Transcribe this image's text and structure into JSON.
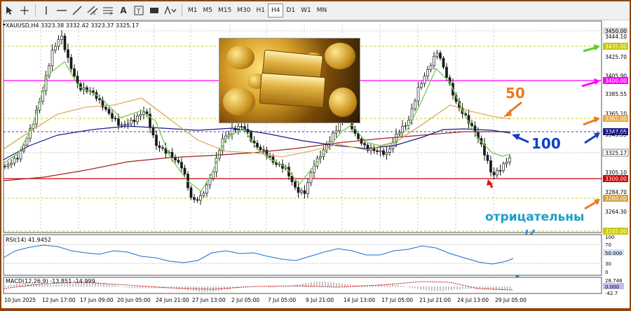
{
  "toolbar": {
    "timeframes": [
      "M1",
      "M5",
      "M15",
      "M30",
      "H1",
      "H4",
      "D1",
      "W1",
      "MN"
    ],
    "active_timeframe": "H4",
    "text_tool_label": "A"
  },
  "chart": {
    "header": "XAUUSD,H4  3323.38 3332.42 3323.37 3325.17",
    "price_labels": [
      "3450.00",
      "3444.10",
      "3435.00",
      "3425.70",
      "3405.90",
      "3400.00",
      "3385.55",
      "3365.10",
      "3362.00",
      "3347.05",
      "3345.35",
      "3325.17",
      "3305.10",
      "3300.00",
      "3284.70",
      "3280.00",
      "3264.30",
      "3245.00"
    ],
    "date_labels": [
      "10 Jun 2025",
      "12 Jun 17:00",
      "17 Jun 09:00",
      "20 Jun 05:00",
      "24 Jun 21:00",
      "27 Jun 13:00",
      "2 Jul 05:00",
      "7 Jul 05:00",
      "9 Jul 21:00",
      "14 Jul 13:00",
      "17 Jul 05:00",
      "21 Jul 21:00",
      "24 Jul 13:00",
      "29 Jul 05:00"
    ],
    "annotation_50": "50",
    "annotation_100": "100",
    "annotation_negative": "отрицательны",
    "rsi_header": "RSI(14) 41.9452",
    "rsi_labels": [
      "100",
      "70",
      "50.000",
      "30",
      "0"
    ],
    "macd_header": "MACD(12,26,9) -13.851 -14.999",
    "macd_labels": [
      "28.748",
      "0.000",
      "-42.7"
    ],
    "colors": {
      "frame": "#8b4513",
      "candle": "#1a1a1a",
      "ma_fast": "#7ccc5a",
      "ma_50": "#d4a040",
      "ma_100": "#1a1a8c",
      "ma_200": "#a02020",
      "level_magenta": "#ff00ff",
      "level_red": "#cc0000",
      "level_yellow": "#c8c800",
      "annotation_orange": "#e87a20",
      "annotation_blue": "#1040cc",
      "text_cyan": "#1aa0c8"
    }
  }
}
